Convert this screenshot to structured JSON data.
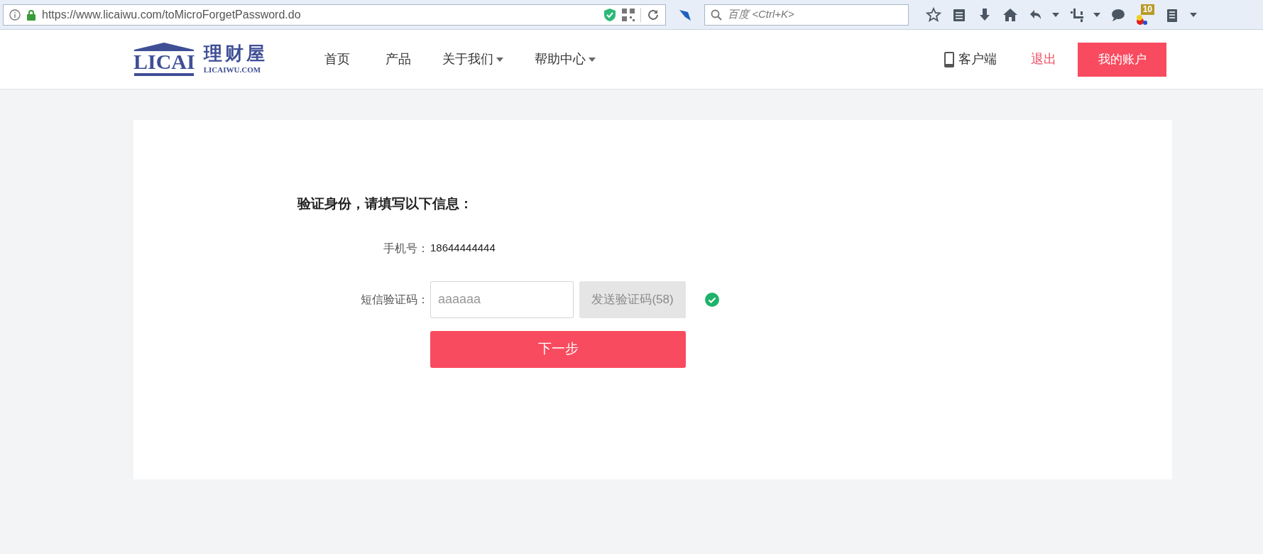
{
  "browser": {
    "url": "https://www.licaiwu.com/toMicroForgetPassword.do",
    "search_placeholder": "百度 <Ctrl+K>",
    "badge": "10"
  },
  "header": {
    "logo": {
      "mark": "LICAI",
      "name": "理财屋",
      "domain": "LICAIWU.COM"
    },
    "nav": [
      {
        "label": "首页",
        "dropdown": false
      },
      {
        "label": "产品",
        "dropdown": false
      },
      {
        "label": "关于我们",
        "dropdown": true
      },
      {
        "label": "帮助中心",
        "dropdown": true
      }
    ],
    "client_link": "客户端",
    "logout_link": "退出",
    "account_button": "我的账户"
  },
  "form": {
    "heading": "验证身份，请填写以下信息：",
    "phone_label": "手机号：",
    "phone_value": "18644444444",
    "code_label": "短信验证码：",
    "code_value": "aaaaaa",
    "send_button": {
      "label": "发送验证码(58)",
      "disabled": true
    },
    "verified": true,
    "next_button": "下一步"
  }
}
